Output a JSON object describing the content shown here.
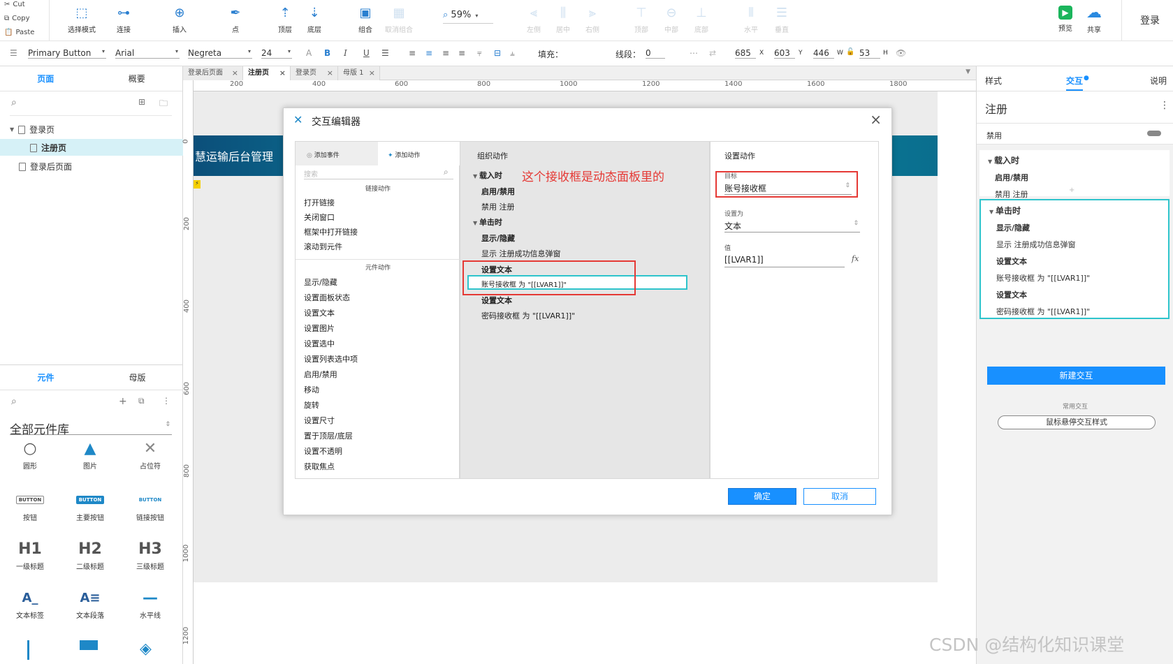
{
  "toolbar": {
    "clipboard": {
      "cut": "Cut",
      "copy": "Copy",
      "paste": "Paste"
    },
    "buttons": [
      {
        "label": "选择模式",
        "enabled": true
      },
      {
        "label": "连接",
        "enabled": true
      },
      {
        "label": "插入",
        "enabled": true
      },
      {
        "label": "点",
        "enabled": true
      },
      {
        "label": "顶层",
        "enabled": true
      },
      {
        "label": "底层",
        "enabled": true
      },
      {
        "label": "组合",
        "enabled": true
      },
      {
        "label": "取消组合",
        "enabled": false
      },
      {
        "label": "左侧",
        "enabled": false
      },
      {
        "label": "居中",
        "enabled": false
      },
      {
        "label": "右侧",
        "enabled": false
      },
      {
        "label": "顶部",
        "enabled": false
      },
      {
        "label": "中部",
        "enabled": false
      },
      {
        "label": "底部",
        "enabled": false
      },
      {
        "label": "水平",
        "enabled": false
      },
      {
        "label": "垂直",
        "enabled": false
      }
    ],
    "zoom": "59%",
    "preview": "预览",
    "share": "共享",
    "login": "登录"
  },
  "format_bar": {
    "style": "Primary Button",
    "font": "Arial",
    "weight": "Negreta",
    "size": "24",
    "fill_label": "填充：",
    "line_label": "线段：",
    "line_value": "0",
    "x": "685",
    "x_unit": "X",
    "y": "603",
    "y_unit": "Y",
    "w": "446",
    "w_unit": "W",
    "h": "53",
    "h_unit": "H"
  },
  "left_panel": {
    "tabs": {
      "pages": "页面",
      "overview": "概要"
    },
    "pages": [
      {
        "label": "登录页",
        "level": 0
      },
      {
        "label": "注册页",
        "level": 1,
        "selected": true
      },
      {
        "label": "登录后页面",
        "level": 0
      }
    ],
    "lib_tabs": {
      "widgets": "元件",
      "masters": "母版"
    },
    "library_name": "全部元件库",
    "widgets": [
      {
        "icon": "○",
        "label": "圆形"
      },
      {
        "icon": "▲",
        "label": "图片"
      },
      {
        "icon": "✕",
        "label": "占位符"
      },
      {
        "icon": "BUTTON",
        "label": "按钮"
      },
      {
        "icon": "BUTTON",
        "label": "主要按钮"
      },
      {
        "icon": "BUTTON",
        "label": "链接按钮"
      },
      {
        "icon": "H1",
        "label": "一级标题"
      },
      {
        "icon": "H2",
        "label": "二级标题"
      },
      {
        "icon": "H3",
        "label": "三级标题"
      },
      {
        "icon": "A_",
        "label": "文本标签"
      },
      {
        "icon": "A≡",
        "label": "文本段落"
      },
      {
        "icon": "—",
        "label": "水平线"
      }
    ]
  },
  "doc_tabs": [
    "登录后页面",
    "注册页",
    "登录页",
    "母版 1"
  ],
  "ruler_h": [
    "200",
    "400",
    "600",
    "800",
    "1000",
    "1200",
    "1400",
    "1600",
    "1800"
  ],
  "ruler_v": [
    "0",
    "200",
    "400",
    "600",
    "800",
    "1000",
    "1200"
  ],
  "canvas": {
    "banner_text": "慧运输后台管理"
  },
  "dialog": {
    "title": "交互编辑器",
    "tab_add_event": "添加事件",
    "tab_add_action": "添加动作",
    "search_placeholder": "搜索",
    "section_link": "链接动作",
    "link_actions": [
      "打开链接",
      "关闭窗口",
      "框架中打开链接",
      "滚动到元件"
    ],
    "section_widget": "元件动作",
    "widget_actions": [
      "显示/隐藏",
      "设置面板状态",
      "设置文本",
      "设置图片",
      "设置选中",
      "设置列表选中项",
      "启用/禁用",
      "移动",
      "旋转",
      "设置尺寸",
      "置于顶层/底层",
      "设置不透明",
      "获取焦点"
    ],
    "organize_title": "组织动作",
    "annotation": "这个接收框是动态面板里的",
    "events": [
      {
        "event": "载入时",
        "actions": [
          {
            "name": "启用/禁用",
            "detail": "禁用 注册"
          }
        ]
      },
      {
        "event": "单击时",
        "actions": [
          {
            "name": "显示/隐藏",
            "detail": "显示 注册成功信息弹窗"
          },
          {
            "name": "设置文本",
            "detail": "账号接收框 为 \"[[LVAR1]]\""
          },
          {
            "name": "设置文本",
            "detail": "密码接收框 为 \"[[LVAR1]]\""
          }
        ]
      }
    ],
    "settings_title": "设置动作",
    "target_label": "目标",
    "target_value": "账号接收框",
    "set_as_label": "设置为",
    "set_as_value": "文本",
    "value_label": "值",
    "value_value": "[[LVAR1]]",
    "fx": "fx",
    "ok": "确定",
    "cancel": "取消"
  },
  "right_panel": {
    "tabs": {
      "style": "样式",
      "interaction": "交互",
      "notes": "说明"
    },
    "widget_name": "注册",
    "disabled_label": "禁用",
    "blocks": [
      {
        "event": "载入时",
        "lines": [
          {
            "text": "启用/禁用",
            "bold": true
          },
          {
            "text": "禁用 注册",
            "bold": false
          }
        ]
      },
      {
        "event": "单击时",
        "lines": [
          {
            "text": "显示/隐藏",
            "bold": true
          },
          {
            "text": "显示 注册成功信息弹窗",
            "bold": false
          },
          {
            "text": "设置文本",
            "bold": true
          },
          {
            "text": "账号接收框 为 \"[[LVAR1]]\"",
            "bold": false
          },
          {
            "text": "设置文本",
            "bold": true
          },
          {
            "text": "密码接收框 为 \"[[LVAR1]]\"",
            "bold": false
          }
        ]
      }
    ],
    "new_interaction": "新建交互",
    "common_label": "常用交互",
    "hover_style": "鼠标悬停交互样式"
  },
  "watermark": "CSDN @结构化知识课堂",
  "colors": {
    "accent": "#1890ff",
    "red_box": "#e53935",
    "cyan_box": "#2ec4cc",
    "banner": "#0b7f9a"
  }
}
